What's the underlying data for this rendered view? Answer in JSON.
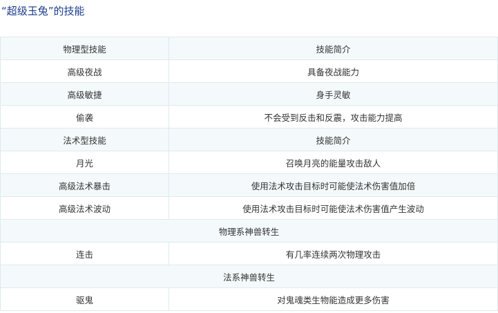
{
  "title": "“超级玉兔”的技能",
  "rows": [
    {
      "type": "pair",
      "cells": [
        "物理型技能",
        "技能简介"
      ]
    },
    {
      "type": "pair",
      "cells": [
        "高级夜战",
        "具备夜战能力"
      ]
    },
    {
      "type": "pair",
      "cells": [
        "高级敏捷",
        "身手灵敏"
      ]
    },
    {
      "type": "pair",
      "cells": [
        "偷袭",
        "不会受到反击和反震，攻击能力提高"
      ]
    },
    {
      "type": "pair",
      "cells": [
        "法术型技能",
        "技能简介"
      ]
    },
    {
      "type": "pair",
      "cells": [
        "月光",
        "召唤月亮的能量攻击敌人"
      ]
    },
    {
      "type": "pair",
      "cells": [
        "高级法术暴击",
        "使用法术攻击目标时可能使法术伤害值加倍"
      ]
    },
    {
      "type": "pair",
      "cells": [
        "高级法术波动",
        "使用法术攻击目标时可能使法术伤害值产生波动"
      ]
    },
    {
      "type": "span",
      "cells": [
        "物理系神兽转生"
      ]
    },
    {
      "type": "pair",
      "cells": [
        "连击",
        "有几率连续两次物理攻击"
      ]
    },
    {
      "type": "span",
      "cells": [
        "法系神兽转生"
      ]
    },
    {
      "type": "pair",
      "cells": [
        "驱鬼",
        "对鬼魂类生物能造成更多伤害"
      ]
    }
  ]
}
